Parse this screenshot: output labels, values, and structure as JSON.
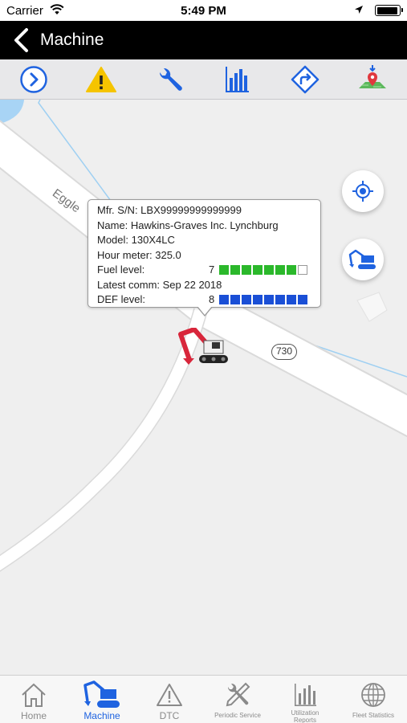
{
  "status_bar": {
    "carrier": "Carrier",
    "time": "5:49 PM"
  },
  "nav": {
    "title": "Machine"
  },
  "toolbar": {
    "icons": [
      "chevron-right-circle-icon",
      "warning-icon",
      "wrench-icon",
      "bar-chart-icon",
      "directions-icon",
      "map-download-icon"
    ]
  },
  "map": {
    "road_label": "Eggle",
    "route_number": "730"
  },
  "info_card": {
    "serial": "Mfr. S/N: LBX99999999999999",
    "name": "Name: Hawkins-Graves Inc. Lynchburg",
    "model": "Model: 130X4LC",
    "hour_meter": "Hour meter: 325.0",
    "fuel_label": "Fuel level:",
    "fuel_value": "7",
    "fuel_level": 7,
    "fuel_max": 8,
    "latest_comm": "Latest comm: Sep 22 2018",
    "def_label": "DEF level:",
    "def_value": "8",
    "def_level": 8,
    "def_max": 8
  },
  "colors": {
    "accent": "#1f63e0",
    "fuel": "#2bb82b",
    "def": "#1a4fd6",
    "excavator": "#d8263b",
    "warning": "#f5c400"
  },
  "tabs": [
    {
      "label": "Home",
      "icon": "home-icon",
      "active": false
    },
    {
      "label": "Machine",
      "icon": "excavator-icon",
      "active": true
    },
    {
      "label": "DTC",
      "icon": "warning-icon",
      "active": false
    },
    {
      "label": "Periodic Service",
      "icon": "tools-icon",
      "active": false
    },
    {
      "label": "Utilization Reports",
      "icon": "bar-chart-icon",
      "active": false
    },
    {
      "label": "Fleet Statistics",
      "icon": "globe-icon",
      "active": false
    }
  ]
}
